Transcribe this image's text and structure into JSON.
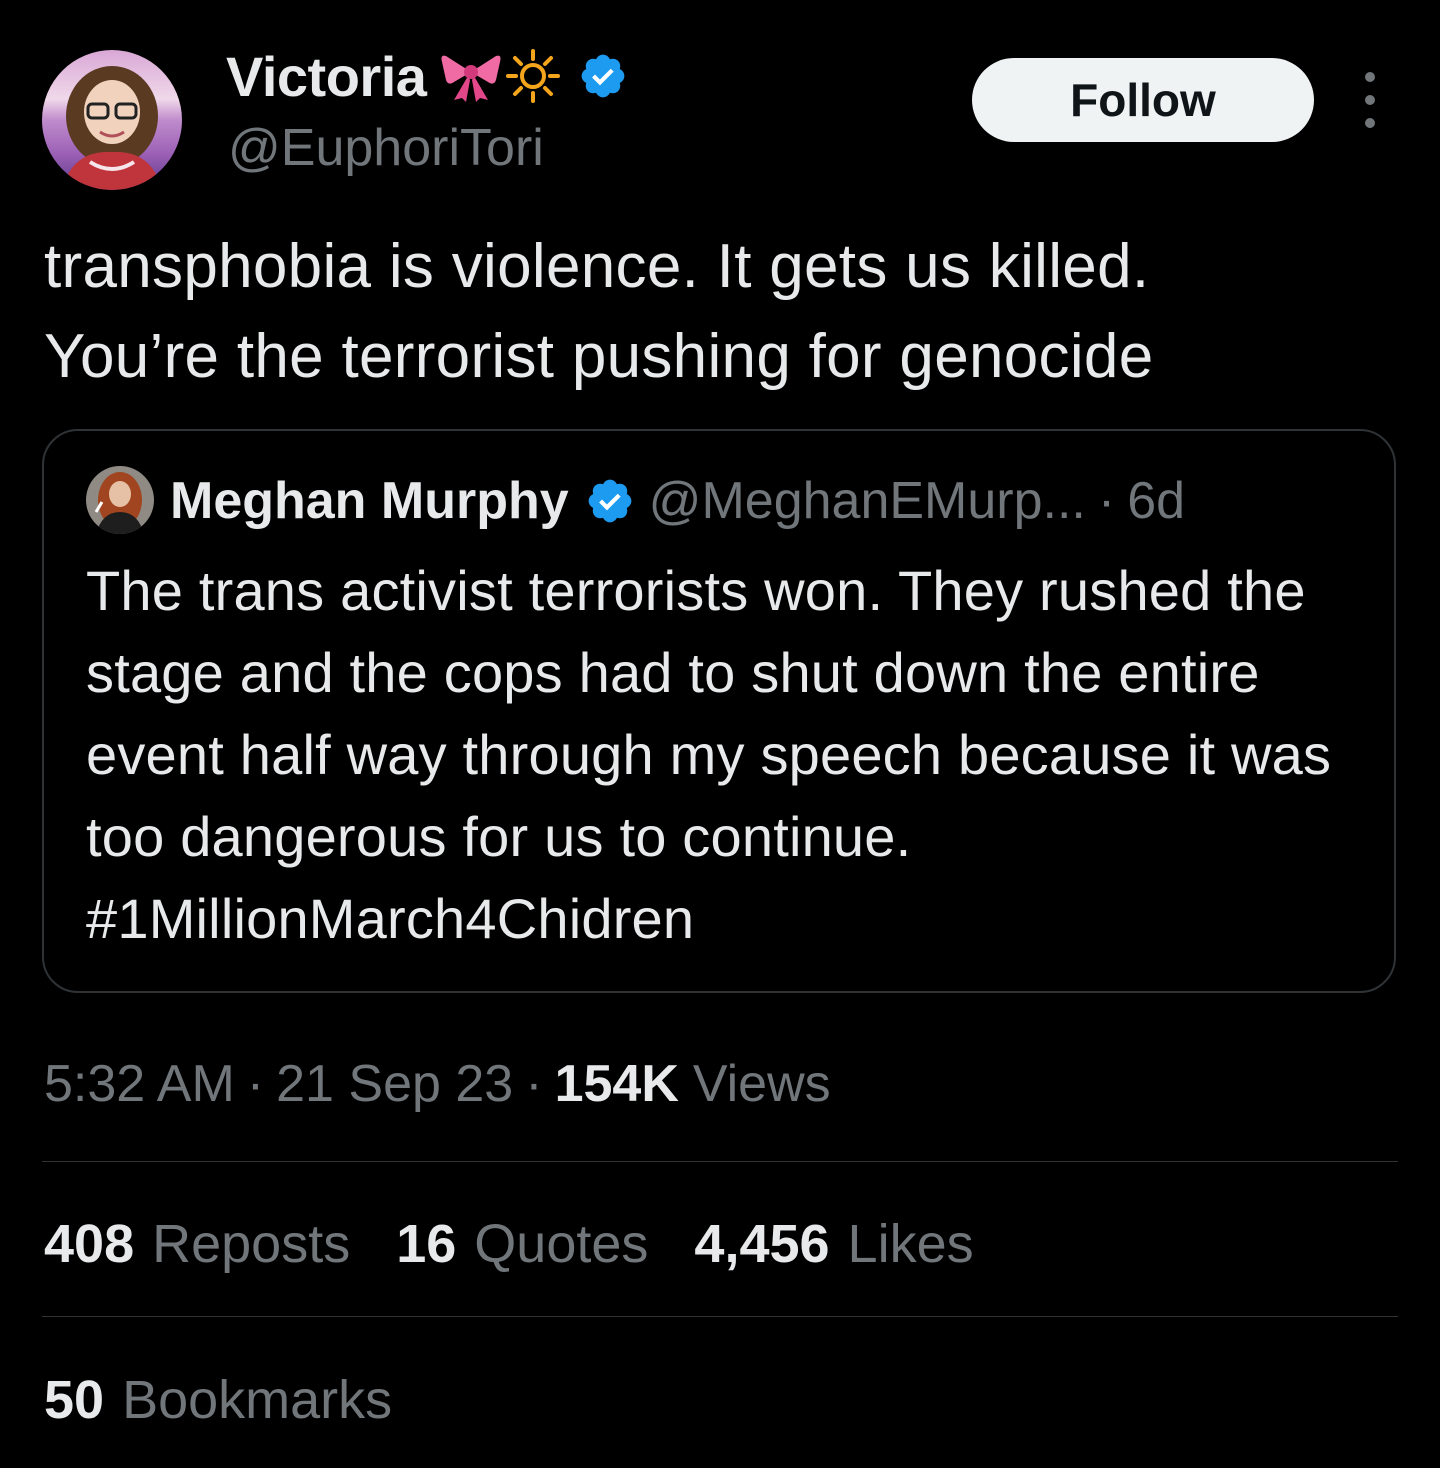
{
  "tweet": {
    "author": {
      "name": "Victoria",
      "handle": "@EuphoriTori",
      "emoji_icons": [
        "ribbon-icon",
        "sun-icon"
      ],
      "verified": true
    },
    "follow_label": "Follow",
    "text": "transphobia is violence. It gets us killed.\nYou’re the terrorist pushing for genocide",
    "quoted": {
      "name": "Meghan Murphy",
      "handle": "@MeghanEMurp...",
      "separator": "·",
      "age": "6d",
      "verified": true,
      "text": "The trans activist terrorists won. They rushed the stage and the cops had to shut down the entire event half way through my speech because it was too dangerous for us to continue. #1MillionMarch4Chidren"
    },
    "meta": {
      "time": "5:32 AM",
      "separator": "·",
      "date": "21 Sep 23",
      "views_count": "154K",
      "views_label": "Views"
    },
    "stats": {
      "reposts": {
        "count": "408",
        "label": "Reposts"
      },
      "quotes": {
        "count": "16",
        "label": "Quotes"
      },
      "likes": {
        "count": "4,456",
        "label": "Likes"
      },
      "bookmarks": {
        "count": "50",
        "label": "Bookmarks"
      }
    }
  },
  "colors": {
    "background": "#000000",
    "text_primary": "#e7e9ea",
    "text_secondary": "#71767b",
    "border": "#2f3336",
    "verified_blue": "#1d9bf0",
    "follow_button_bg": "#eff3f4"
  }
}
